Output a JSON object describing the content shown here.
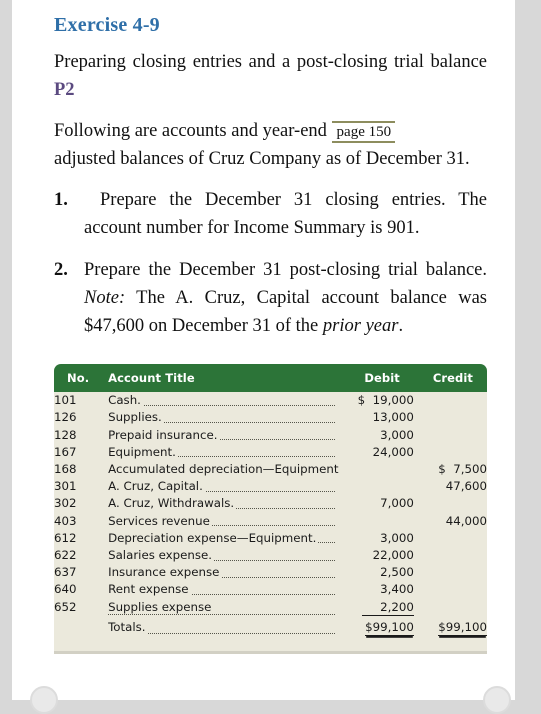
{
  "exercise": {
    "title": "Exercise 4-9",
    "subtitle_text": "Preparing closing entries and a post-closing trial balance",
    "subtitle_code": "P2"
  },
  "intro": {
    "text_before_marker": "Following are accounts and year-end",
    "page_marker": "page 150",
    "text_after_marker": "adjusted balances of Cruz Company as of December 31."
  },
  "requirements": [
    {
      "number": "1.",
      "text": "Prepare the December 31 closing entries. The account number for Income Summary is 901."
    },
    {
      "number": "2.",
      "text_part1": "Prepare the December 31 post-closing trial balance. ",
      "note_label": "Note:",
      "text_part2": " The A. Cruz, Capital account balance was $47,600 on December 31 of the ",
      "italic_tail": "prior year",
      "text_part3": "."
    }
  ],
  "table": {
    "headers": {
      "no": "No.",
      "account_title": "Account Title",
      "debit": "Debit",
      "credit": "Credit"
    },
    "rows": [
      {
        "no": "101",
        "title": "Cash.",
        "debit_cur": "$",
        "debit": "19,000",
        "credit_cur": "",
        "credit": ""
      },
      {
        "no": "126",
        "title": "Supplies.",
        "debit_cur": "",
        "debit": "13,000",
        "credit_cur": "",
        "credit": ""
      },
      {
        "no": "128",
        "title": "Prepaid insurance.",
        "debit_cur": "",
        "debit": "3,000",
        "credit_cur": "",
        "credit": ""
      },
      {
        "no": "167",
        "title": "Equipment.",
        "debit_cur": "",
        "debit": "24,000",
        "credit_cur": "",
        "credit": ""
      },
      {
        "no": "168",
        "title": "Accumulated depreciation—Equipment",
        "debit_cur": "",
        "debit": "",
        "credit_cur": "$",
        "credit": "7,500"
      },
      {
        "no": "301",
        "title": "A. Cruz, Capital.",
        "debit_cur": "",
        "debit": "",
        "credit_cur": "",
        "credit": "47,600"
      },
      {
        "no": "302",
        "title": "A. Cruz, Withdrawals.",
        "debit_cur": "",
        "debit": "7,000",
        "credit_cur": "",
        "credit": ""
      },
      {
        "no": "403",
        "title": "Services revenue",
        "debit_cur": "",
        "debit": "",
        "credit_cur": "",
        "credit": "44,000"
      },
      {
        "no": "612",
        "title": "Depreciation expense—Equipment.",
        "debit_cur": "",
        "debit": "3,000",
        "credit_cur": "",
        "credit": ""
      },
      {
        "no": "622",
        "title": "Salaries expense.",
        "debit_cur": "",
        "debit": "22,000",
        "credit_cur": "",
        "credit": ""
      },
      {
        "no": "637",
        "title": "Insurance expense",
        "debit_cur": "",
        "debit": "2,500",
        "credit_cur": "",
        "credit": ""
      },
      {
        "no": "640",
        "title": "Rent expense",
        "debit_cur": "",
        "debit": "3,400",
        "credit_cur": "",
        "credit": ""
      },
      {
        "no": "652",
        "title": "Supplies expense",
        "debit_cur": "",
        "debit": "2,200",
        "credit_cur": "",
        "credit": ""
      }
    ],
    "totals": {
      "no": "",
      "title": "Totals.",
      "debit": "$99,100",
      "credit": "$99,100"
    }
  },
  "colors": {
    "heading_blue": "#2f6fa8",
    "code_purple": "#5b4a80",
    "header_green": "#2c7438",
    "table_body": "#ebe9dc",
    "marker_olive": "#8d8d5e"
  }
}
